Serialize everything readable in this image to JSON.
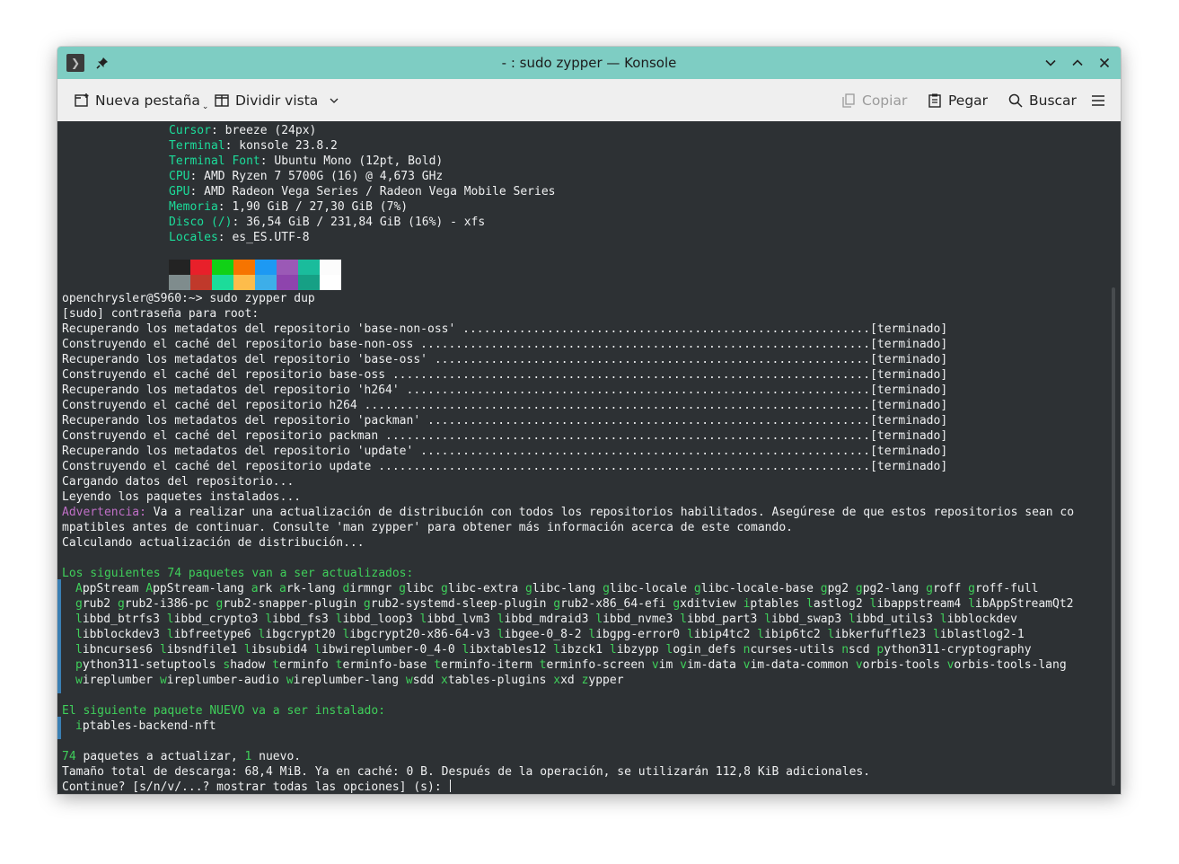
{
  "window": {
    "title": "- : sudo zypper — Konsole"
  },
  "titlebar_icons": {
    "app": "konsole-app-icon",
    "pin": "pin-icon",
    "minimize": "chevron-down-icon",
    "maximize": "chevron-up-icon",
    "close": "close-icon"
  },
  "toolbar": {
    "new_tab": "Nueva pestaña",
    "split_view": "Dividir vista",
    "copy": "Copiar",
    "paste": "Pegar",
    "search": "Buscar"
  },
  "colors": {
    "titlebar": "#7ecdc3",
    "terminal_bg": "#2d3134",
    "key": "#1cdc9a",
    "warning": "#bf6fc6",
    "package_initial": "#3fcf5a"
  },
  "sysinfo": [
    {
      "key": "Cursor",
      "value": ": breeze (24px)"
    },
    {
      "key": "Terminal",
      "value": ": konsole 23.8.2"
    },
    {
      "key": "Terminal Font",
      "value": ": Ubuntu Mono (12pt, Bold)"
    },
    {
      "key": "CPU",
      "value": ": AMD Ryzen 7 5700G (16) @ 4,673 GHz"
    },
    {
      "key": "GPU",
      "value": ": AMD Radeon Vega Series / Radeon Vega Mobile Series"
    },
    {
      "key": "Memoria",
      "value": ": 1,90 GiB / 27,30 GiB (7%)"
    },
    {
      "key": "Disco (/)",
      "value": ": 36,54 GiB / 231,84 GiB (16%) - xfs"
    },
    {
      "key": "Locales",
      "value": ": es_ES.UTF-8"
    }
  ],
  "palette": [
    "#232323",
    "#e8202a",
    "#11d116",
    "#f67400",
    "#1d99f3",
    "#9b59b6",
    "#1abc9c",
    "#fcfcfc",
    "#7f8c8d",
    "#c0392b",
    "#1cdc9a",
    "#fdbc4b",
    "#3daee9",
    "#8e44ad",
    "#16a085",
    "#ffffff"
  ],
  "session": [
    "openchrysler@S960:~> sudo zypper dup",
    "[sudo] contraseña para root:",
    "Recuperando los metadatos del repositorio 'base-non-oss' ..........................................................[terminado]",
    "Construyendo el caché del repositorio base-non-oss ................................................................[terminado]",
    "Recuperando los metadatos del repositorio 'base-oss' ..............................................................[terminado]",
    "Construyendo el caché del repositorio base-oss ....................................................................[terminado]",
    "Recuperando los metadatos del repositorio 'h264' ..................................................................[terminado]",
    "Construyendo el caché del repositorio h264 ........................................................................[terminado]",
    "Recuperando los metadatos del repositorio 'packman' ...............................................................[terminado]",
    "Construyendo el caché del repositorio packman .....................................................................[terminado]",
    "Recuperando los metadatos del repositorio 'update' ................................................................[terminado]",
    "Construyendo el caché del repositorio update ......................................................................[terminado]",
    "Cargando datos del repositorio...",
    "Leyendo los paquetes instalados..."
  ],
  "warning": {
    "label": "Advertencia:",
    "line1": " Va a realizar una actualización de distribución con todos los repositorios habilitados. Asegúrese de que estos repositorios sean co",
    "line2": "mpatibles antes de continuar. Consulte 'man zypper' para obtener más información acerca de este comando."
  },
  "calculating": "Calculando actualización de distribución...",
  "upgrade_heading": "Los siguientes 74 paquetes van a ser actualizados:",
  "upgrade_packages": [
    [
      "AppStream",
      "AppStream-lang",
      "ark",
      "ark-lang",
      "dirmngr",
      "glibc",
      "glibc-extra",
      "glibc-lang",
      "glibc-locale",
      "glibc-locale-base",
      "gpg2",
      "gpg2-lang",
      "groff",
      "groff-full"
    ],
    [
      "grub2",
      "grub2-i386-pc",
      "grub2-snapper-plugin",
      "grub2-systemd-sleep-plugin",
      "grub2-x86_64-efi",
      "gxditview",
      "iptables",
      "lastlog2",
      "libappstream4",
      "libAppStreamQt2"
    ],
    [
      "libbd_btrfs3",
      "libbd_crypto3",
      "libbd_fs3",
      "libbd_loop3",
      "libbd_lvm3",
      "libbd_mdraid3",
      "libbd_nvme3",
      "libbd_part3",
      "libbd_swap3",
      "libbd_utils3",
      "libblockdev"
    ],
    [
      "libblockdev3",
      "libfreetype6",
      "libgcrypt20",
      "libgcrypt20-x86-64-v3",
      "libgee-0_8-2",
      "libgpg-error0",
      "libip4tc2",
      "libip6tc2",
      "libkerfuffle23",
      "liblastlog2-1"
    ],
    [
      "libncurses6",
      "libsndfile1",
      "libsubid4",
      "libwireplumber-0_4-0",
      "libxtables12",
      "libzck1",
      "libzypp",
      "login_defs",
      "ncurses-utils",
      "nscd",
      "python311-cryptography"
    ],
    [
      "python311-setuptools",
      "shadow",
      "terminfo",
      "terminfo-base",
      "terminfo-iterm",
      "terminfo-screen",
      "vim",
      "vim-data",
      "vim-data-common",
      "vorbis-tools",
      "vorbis-tools-lang"
    ],
    [
      "wireplumber",
      "wireplumber-audio",
      "wireplumber-lang",
      "wsdd",
      "xtables-plugins",
      "xxd",
      "zypper"
    ]
  ],
  "new_heading": "El siguiente paquete NUEVO va a ser instalado:",
  "new_packages": [
    "iptables-backend-nft"
  ],
  "summary": {
    "count": "74",
    "text1": " paquetes a actualizar, ",
    "new_count": "1",
    "text2": " nuevo."
  },
  "download": "Tamaño total de descarga: 68,4 MiB. Ya en caché: 0 B. Después de la operación, se utilizarán 112,8 KiB adicionales.",
  "prompt": "Continue? [s/n/v/...? mostrar todas las opciones] (s): "
}
